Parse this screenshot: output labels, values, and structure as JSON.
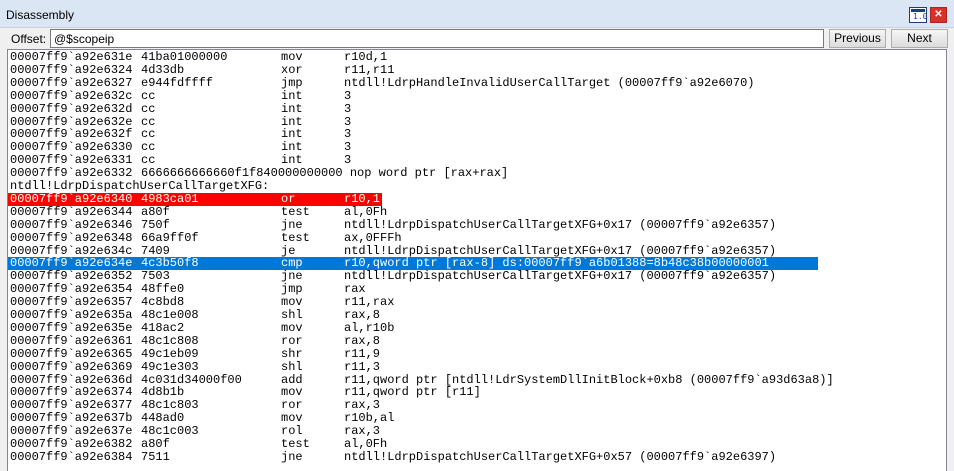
{
  "window": {
    "title": "Disassembly",
    "restore_glyph": "1.0",
    "close_glyph": "✕"
  },
  "offset": {
    "label": "Offset:",
    "value": "@$scopeip",
    "previous_label": "Previous",
    "next_label": "Next"
  },
  "colors": {
    "current_line": "#ff0000",
    "selected_line": "#0078d7"
  },
  "listing": [
    {
      "type": "instr",
      "addr": "00007ff9`a92e631e",
      "bytes": "41ba01000000",
      "mnem": "mov",
      "ops": "r10d,1"
    },
    {
      "type": "instr",
      "addr": "00007ff9`a92e6324",
      "bytes": "4d33db",
      "mnem": "xor",
      "ops": "r11,r11"
    },
    {
      "type": "instr",
      "addr": "00007ff9`a92e6327",
      "bytes": "e944fdffff",
      "mnem": "jmp",
      "ops": "ntdll!LdrpHandleInvalidUserCallTarget (00007ff9`a92e6070)"
    },
    {
      "type": "instr",
      "addr": "00007ff9`a92e632c",
      "bytes": "cc",
      "mnem": "int",
      "ops": "3"
    },
    {
      "type": "instr",
      "addr": "00007ff9`a92e632d",
      "bytes": "cc",
      "mnem": "int",
      "ops": "3"
    },
    {
      "type": "instr",
      "addr": "00007ff9`a92e632e",
      "bytes": "cc",
      "mnem": "int",
      "ops": "3"
    },
    {
      "type": "instr",
      "addr": "00007ff9`a92e632f",
      "bytes": "cc",
      "mnem": "int",
      "ops": "3"
    },
    {
      "type": "instr",
      "addr": "00007ff9`a92e6330",
      "bytes": "cc",
      "mnem": "int",
      "ops": "3"
    },
    {
      "type": "instr",
      "addr": "00007ff9`a92e6331",
      "bytes": "cc",
      "mnem": "int",
      "ops": "3"
    },
    {
      "type": "raw",
      "addr": "00007ff9`a92e6332",
      "text": "6666666666660f1f840000000000 nop word ptr [rax+rax]"
    },
    {
      "type": "label",
      "text": "ntdll!LdrpDispatchUserCallTargetXFG:"
    },
    {
      "type": "instr",
      "addr": "00007ff9`a92e6340",
      "bytes": "4983ca01",
      "mnem": "or",
      "ops": "r10,1",
      "highlight": "current"
    },
    {
      "type": "instr",
      "addr": "00007ff9`a92e6344",
      "bytes": "a80f",
      "mnem": "test",
      "ops": "al,0Fh"
    },
    {
      "type": "instr",
      "addr": "00007ff9`a92e6346",
      "bytes": "750f",
      "mnem": "jne",
      "ops": "ntdll!LdrpDispatchUserCallTargetXFG+0x17 (00007ff9`a92e6357)"
    },
    {
      "type": "instr",
      "addr": "00007ff9`a92e6348",
      "bytes": "66a9ff0f",
      "mnem": "test",
      "ops": "ax,0FFFh"
    },
    {
      "type": "instr",
      "addr": "00007ff9`a92e634c",
      "bytes": "7409",
      "mnem": "je",
      "ops": "ntdll!LdrpDispatchUserCallTargetXFG+0x17 (00007ff9`a92e6357)"
    },
    {
      "type": "instr",
      "addr": "00007ff9`a92e634e",
      "bytes": "4c3b50f8",
      "mnem": "cmp",
      "ops": "r10,qword ptr [rax-8] ds:00007ff9`a6b01388=8b48c38b00000001",
      "highlight": "selected"
    },
    {
      "type": "instr",
      "addr": "00007ff9`a92e6352",
      "bytes": "7503",
      "mnem": "jne",
      "ops": "ntdll!LdrpDispatchUserCallTargetXFG+0x17 (00007ff9`a92e6357)"
    },
    {
      "type": "instr",
      "addr": "00007ff9`a92e6354",
      "bytes": "48ffe0",
      "mnem": "jmp",
      "ops": "rax"
    },
    {
      "type": "instr",
      "addr": "00007ff9`a92e6357",
      "bytes": "4c8bd8",
      "mnem": "mov",
      "ops": "r11,rax"
    },
    {
      "type": "instr",
      "addr": "00007ff9`a92e635a",
      "bytes": "48c1e008",
      "mnem": "shl",
      "ops": "rax,8"
    },
    {
      "type": "instr",
      "addr": "00007ff9`a92e635e",
      "bytes": "418ac2",
      "mnem": "mov",
      "ops": "al,r10b"
    },
    {
      "type": "instr",
      "addr": "00007ff9`a92e6361",
      "bytes": "48c1c808",
      "mnem": "ror",
      "ops": "rax,8"
    },
    {
      "type": "instr",
      "addr": "00007ff9`a92e6365",
      "bytes": "49c1eb09",
      "mnem": "shr",
      "ops": "r11,9"
    },
    {
      "type": "instr",
      "addr": "00007ff9`a92e6369",
      "bytes": "49c1e303",
      "mnem": "shl",
      "ops": "r11,3"
    },
    {
      "type": "instr",
      "addr": "00007ff9`a92e636d",
      "bytes": "4c031d34000f00",
      "mnem": "add",
      "ops": "r11,qword ptr [ntdll!LdrSystemDllInitBlock+0xb8 (00007ff9`a93d63a8)]"
    },
    {
      "type": "instr",
      "addr": "00007ff9`a92e6374",
      "bytes": "4d8b1b",
      "mnem": "mov",
      "ops": "r11,qword ptr [r11]"
    },
    {
      "type": "instr",
      "addr": "00007ff9`a92e6377",
      "bytes": "48c1c803",
      "mnem": "ror",
      "ops": "rax,3"
    },
    {
      "type": "instr",
      "addr": "00007ff9`a92e637b",
      "bytes": "448ad0",
      "mnem": "mov",
      "ops": "r10b,al"
    },
    {
      "type": "instr",
      "addr": "00007ff9`a92e637e",
      "bytes": "48c1c003",
      "mnem": "rol",
      "ops": "rax,3"
    },
    {
      "type": "instr",
      "addr": "00007ff9`a92e6382",
      "bytes": "a80f",
      "mnem": "test",
      "ops": "al,0Fh"
    },
    {
      "type": "instr",
      "addr": "00007ff9`a92e6384",
      "bytes": "7511",
      "mnem": "jne",
      "ops": "ntdll!LdrpDispatchUserCallTargetXFG+0x57 (00007ff9`a92e6397)"
    }
  ]
}
